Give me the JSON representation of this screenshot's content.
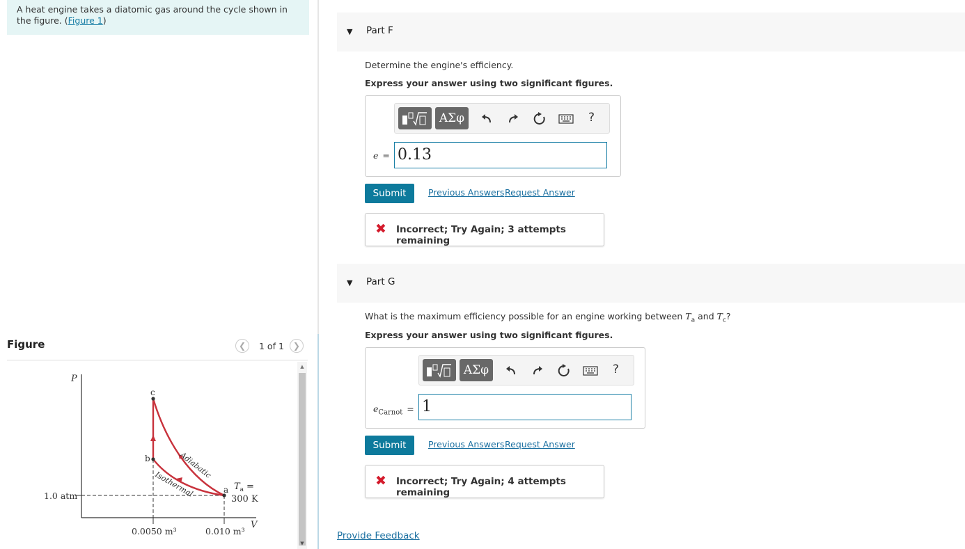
{
  "problem": {
    "text": "A heat engine takes a diatomic gas around the cycle shown in the figure.",
    "link_open": "(",
    "link": "Figure 1",
    "link_close": ")"
  },
  "figure_panel": {
    "title": "Figure",
    "counter": "1 of 1",
    "prev_icon": "chevron-left",
    "next_icon": "chevron-right"
  },
  "diagram": {
    "p_axis": "P",
    "v_axis": "V",
    "pressure_label": "1.0 atm",
    "volume_b": "0.0050 m³",
    "volume_a": "0.010 m³",
    "point_a": "a",
    "point_b": "b",
    "point_c": "c",
    "curve_upper": "Adiabatic",
    "curve_lower": "Isothermal",
    "temp_symbol": "T",
    "temp_subscript": "a",
    "temp_eq": "=",
    "temp_value": "300 K",
    "curve_color": "#c8323c"
  },
  "partF": {
    "label": "Part F",
    "question": "Determine the engine's efficiency.",
    "instruction": "Express your answer using two significant figures.",
    "var": "e",
    "equals": "=",
    "answer": "0.13",
    "submit": "Submit",
    "previous": "Previous Answers",
    "request": "Request Answer",
    "feedback": "Incorrect; Try Again; 3 attempts remaining"
  },
  "partG": {
    "label": "Part G",
    "question_pre": "What is the maximum efficiency possible for an engine working between",
    "Ta_symbol": "T",
    "Ta_sub": "a",
    "and": "and",
    "Tc_symbol": "T",
    "Tc_sub": "c",
    "question_end": "?",
    "instruction": "Express your answer using two significant figures.",
    "var": "e",
    "var_sub": "Carnot",
    "equals": "=",
    "answer": "1",
    "submit": "Submit",
    "previous": "Previous Answers",
    "request": "Request Answer",
    "feedback": "Incorrect; Try Again; 4 attempts remaining"
  },
  "toolbar": {
    "greek_label": "ΑΣφ",
    "help_label": "?",
    "icons": [
      "templates-icon",
      "greek-icon",
      "undo-icon",
      "redo-icon",
      "reset-icon",
      "keyboard-icon",
      "help-icon"
    ]
  },
  "footer": {
    "provide_feedback": "Provide Feedback"
  },
  "colors": {
    "accent": "#0d7a9c",
    "error": "#d41b2c",
    "problem_bg": "#e5f5f5"
  }
}
